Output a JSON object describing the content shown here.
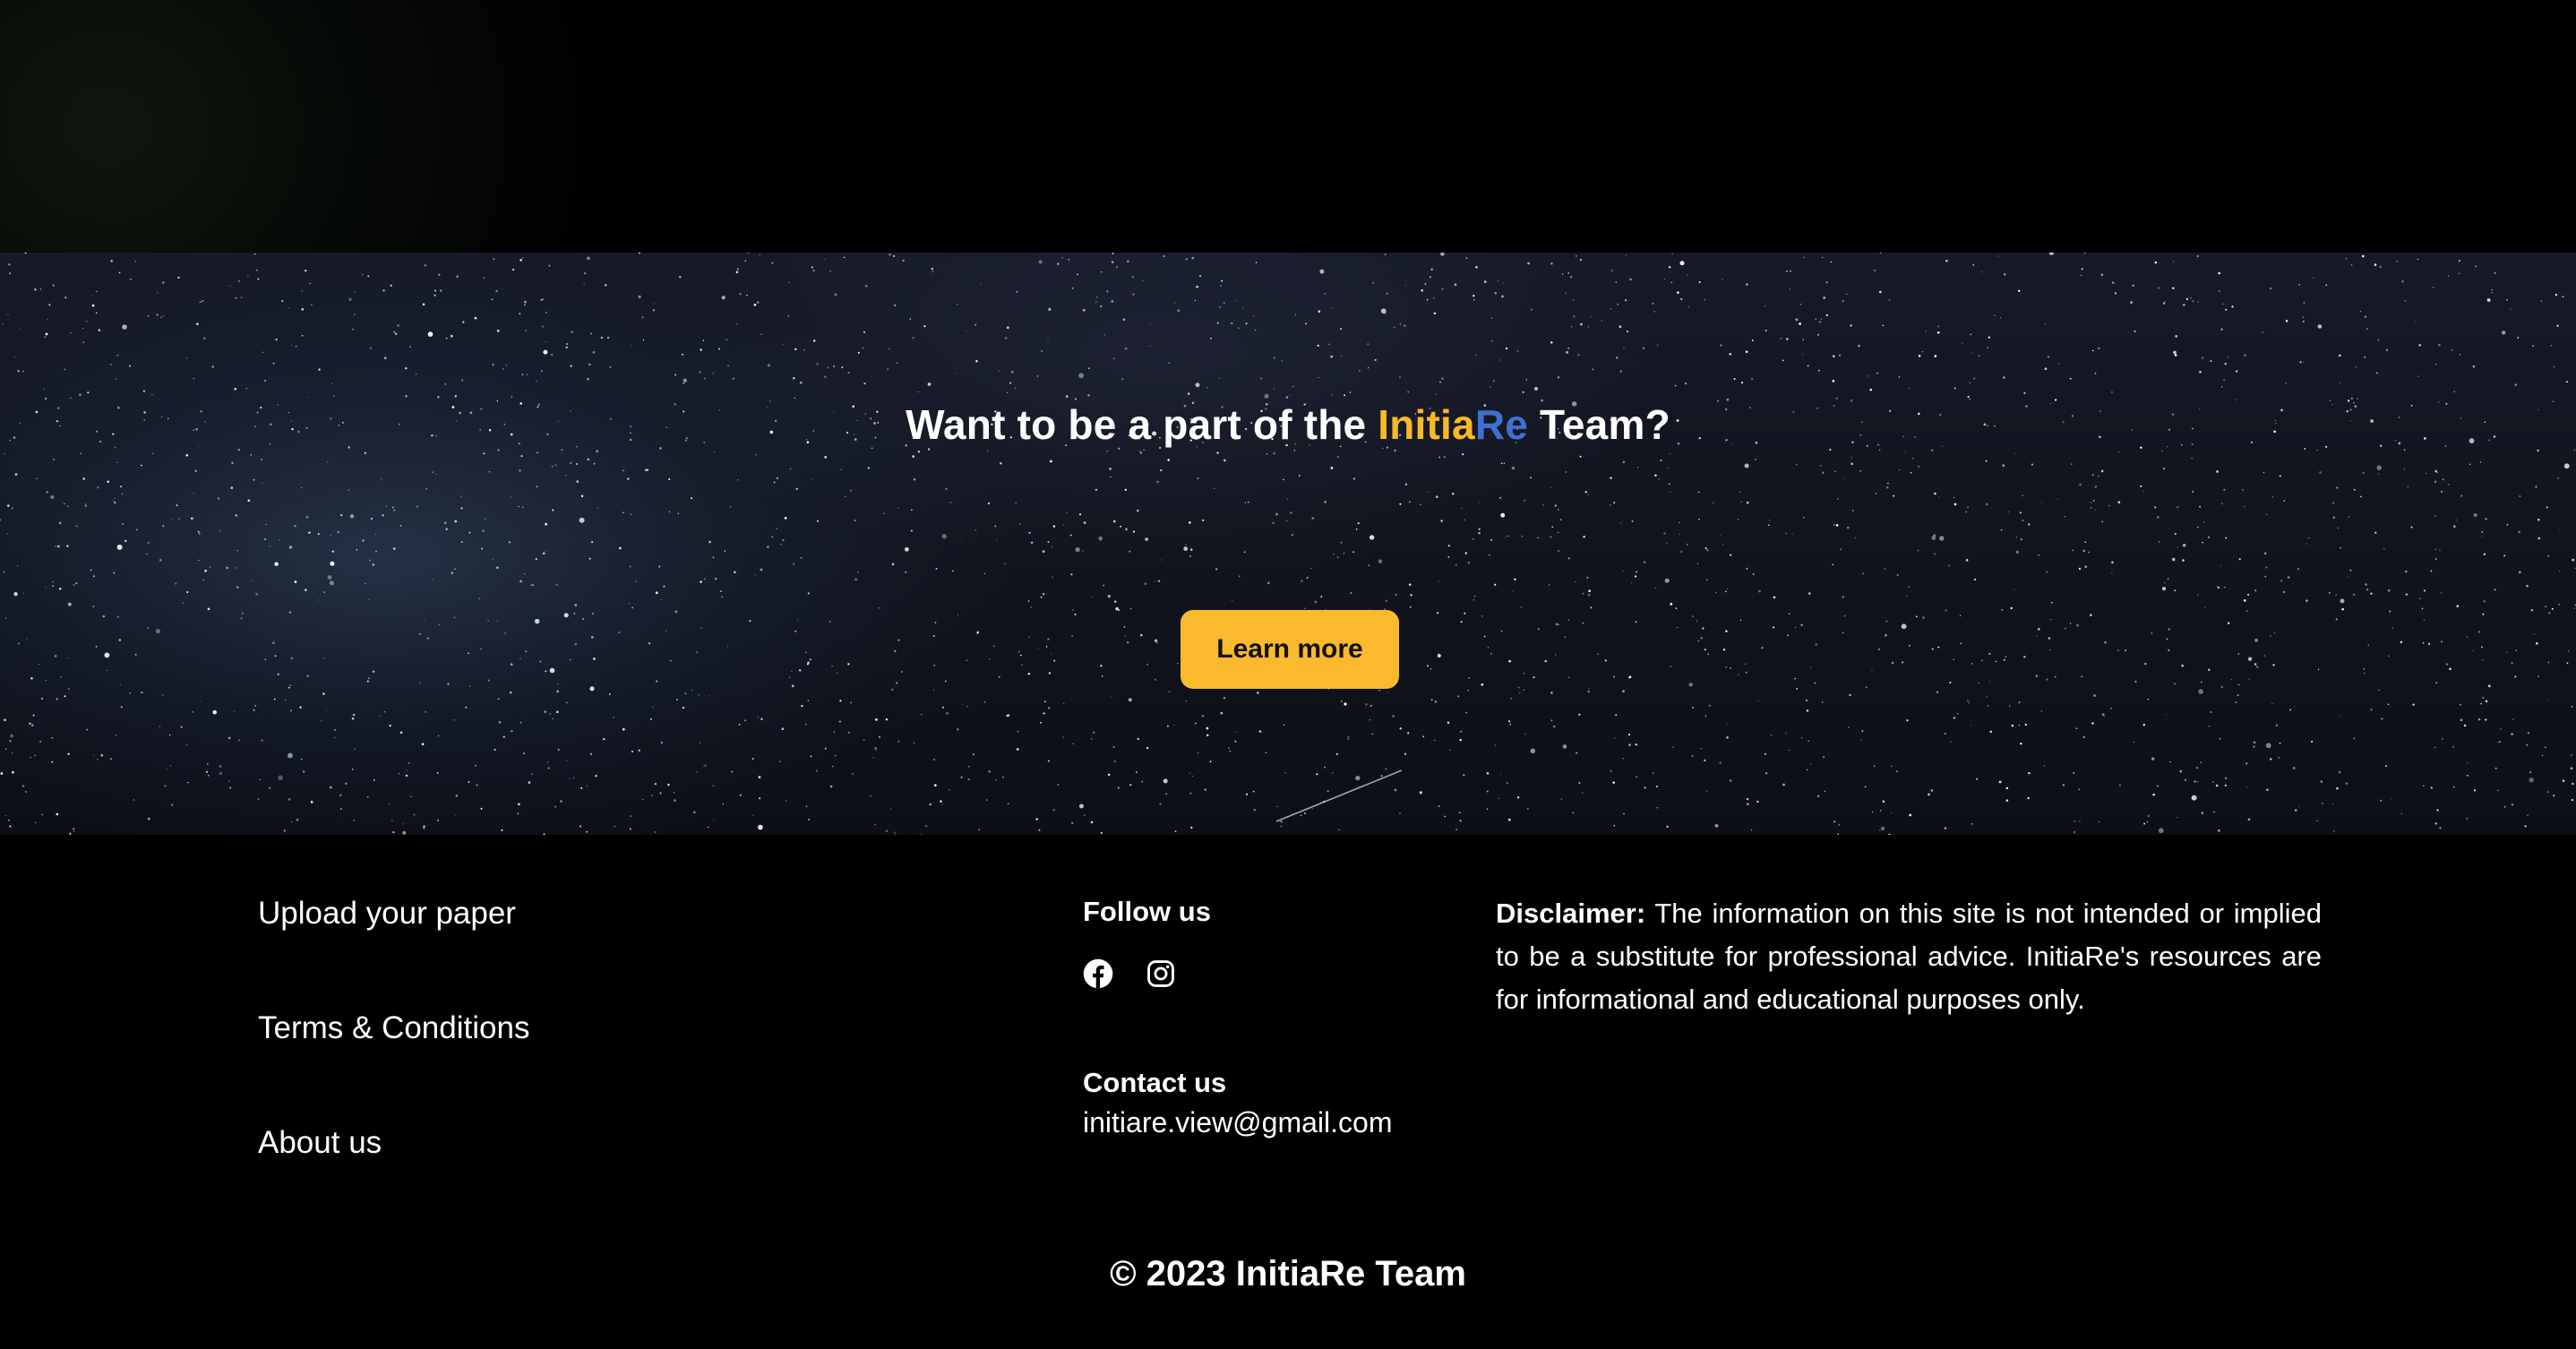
{
  "hero": {
    "title_prefix": "Want to be a part of the ",
    "brand_part_1": "Initia",
    "brand_part_2": "Re",
    "title_suffix": " Team?",
    "button_label": "Learn more"
  },
  "footer": {
    "links": [
      {
        "label": "Upload your paper"
      },
      {
        "label": "Terms & Conditions"
      },
      {
        "label": "About us"
      }
    ],
    "follow_heading": "Follow us",
    "social": [
      {
        "icon": "facebook-icon"
      },
      {
        "icon": "instagram-icon"
      }
    ],
    "contact_heading": "Contact us",
    "contact_email": "initiare.view@gmail.com",
    "disclaimer_label": "Disclaimer:",
    "disclaimer_text": " The information on this site is not intended or implied to be a substitute for professional advice. InitiaRe's resources are for informational and educational purposes only.",
    "copyright": "© 2023 InitiaRe Team"
  },
  "colors": {
    "accent_yellow": "#fbb92d",
    "brand_blue": "#3f6fd1",
    "background": "#000000"
  }
}
